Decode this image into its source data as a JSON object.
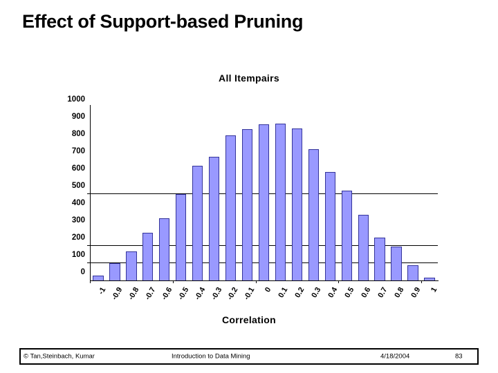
{
  "slide": {
    "title": "Effect of Support-based Pruning",
    "divider_top_color": "#00B0C8",
    "divider_bottom_color": "#A000A0"
  },
  "footer": {
    "copyright": "© Tan,Steinbach, Kumar",
    "course": "Introduction to Data Mining",
    "date": "4/18/2004",
    "page": "83"
  },
  "chart_data": {
    "type": "bar",
    "title": "All Itempairs",
    "xlabel": "Correlation",
    "ylabel": "",
    "grid": true,
    "legend": null,
    "ylim": [
      0,
      1000
    ],
    "yticks": [
      0,
      100,
      200,
      300,
      400,
      500,
      600,
      700,
      800,
      900,
      1000
    ],
    "ytick_labels": [
      "0",
      "100",
      "200",
      "300",
      "400",
      "500",
      "600",
      "700",
      "800",
      "900",
      "1000"
    ],
    "gridline_values": [
      100,
      200,
      500
    ],
    "bar_color": "#9999FF",
    "bar_border_color": "#333399",
    "categories": [
      "-1",
      "-0.9",
      "-0.8",
      "-0.7",
      "-0.6",
      "-0.5",
      "-0.4",
      "-0.3",
      "-0.2",
      "-0.1",
      "0",
      "0.1",
      "0.2",
      "0.3",
      "0.4",
      "0.5",
      "0.6",
      "0.7",
      "0.8",
      "0.9",
      "1"
    ],
    "values": [
      30,
      100,
      170,
      275,
      360,
      500,
      665,
      715,
      840,
      875,
      905,
      910,
      880,
      760,
      630,
      520,
      380,
      250,
      195,
      90,
      15
    ]
  }
}
